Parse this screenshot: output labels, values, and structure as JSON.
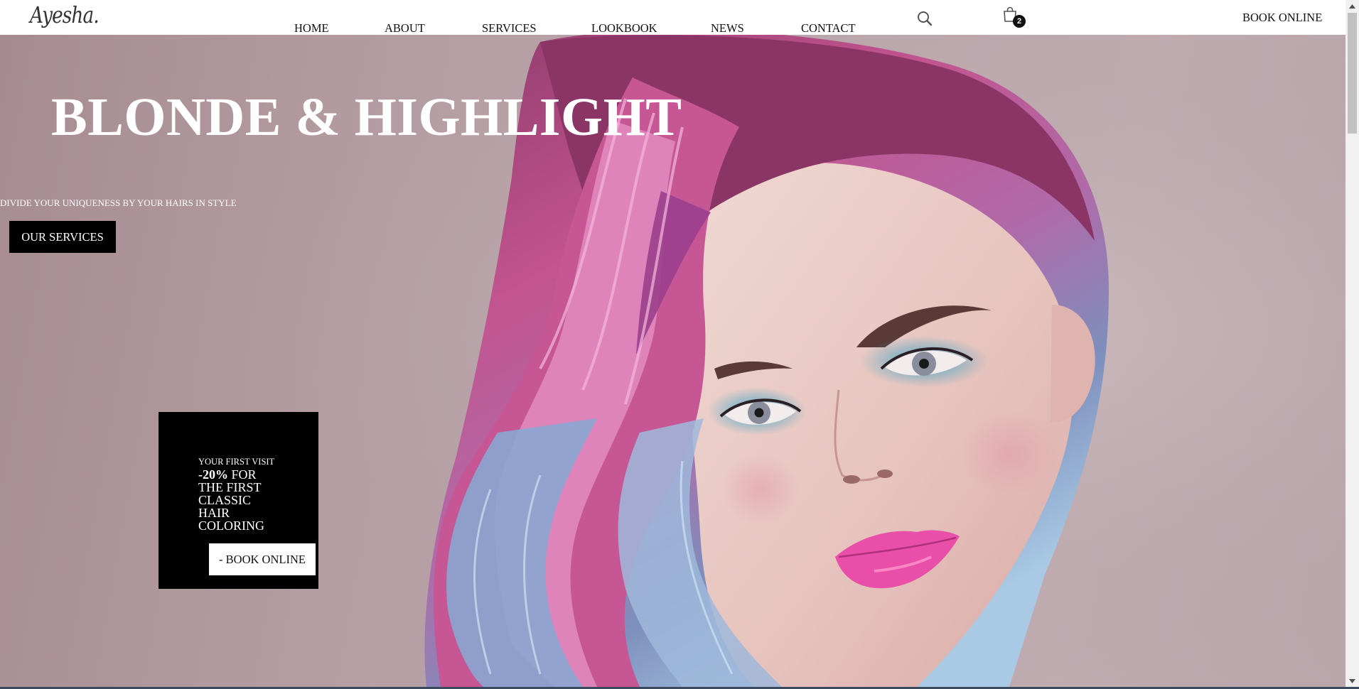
{
  "header": {
    "logo": "Ayesha.",
    "nav": [
      {
        "label": "HOME"
      },
      {
        "label": "ABOUT"
      },
      {
        "label": "SERVICES"
      },
      {
        "label": "LOOKBOOK"
      },
      {
        "label": "NEWS"
      },
      {
        "label": "CONTACT"
      }
    ],
    "search_icon": "search-icon",
    "cart_icon": "shopping-bag-icon",
    "cart_count": "2",
    "book_online": "BOOK ONLINE"
  },
  "hero": {
    "title": "BLONDE & HIGHLIGHT",
    "subtitle": "DIVIDE YOUR UNIQUENESS BY YOUR HAIRS IN STYLE",
    "services_button": "OUR SERVICES",
    "promo": {
      "kicker": "YOUR FIRST VISIT",
      "discount": "-20%",
      "text": " FOR THE FIRST CLASSIC HAIR COLORING",
      "button": "- BOOK ONLINE"
    }
  },
  "colors": {
    "hero_background": "#b59ea3",
    "hair_magenta": "#a03c78",
    "hair_pink": "#e27ab8",
    "hair_blue": "#8fb2d6",
    "skin": "#e8c8c2",
    "lips": "#e94fa8",
    "eyeshadow": "#3a9fc4",
    "promo_background": "#000000"
  }
}
